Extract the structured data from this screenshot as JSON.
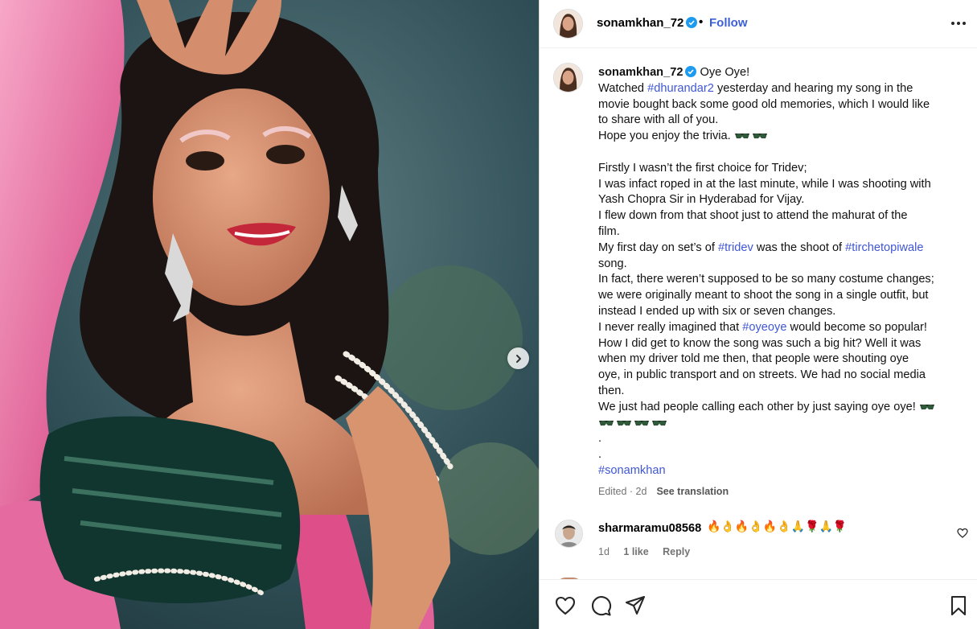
{
  "post": {
    "username": "sonamkhan_72",
    "follow_label": "Follow",
    "dot": "•",
    "caption_lines": [
      {
        "text": "Watched "
      },
      {
        "text": "movie bought back some good old memories, which I would like"
      },
      {
        "text": "to share with all of you."
      },
      {
        "text": "Hope you enjoy the trivia."
      },
      {
        "text": ""
      },
      {
        "text": "Firstly I wasn’t the first choice for Tridev;"
      },
      {
        "text": "I was infact roped in at the last minute, while I was shooting with"
      },
      {
        "text": "Yash Chopra Sir in Hyderabad for Vijay."
      },
      {
        "text": "I flew down from that shoot just to attend the mahurat of the"
      },
      {
        "text": "film."
      },
      {
        "text": "My first day on set’s of "
      },
      {
        "text": "song."
      },
      {
        "text": "In fact, there weren’t supposed to be so many costume changes;"
      },
      {
        "text": "we were originally meant to shoot the song in a single outfit, but"
      },
      {
        "text": "instead I ended up with six or seven changes."
      },
      {
        "text": "I never really imagined that "
      },
      {
        "text": "How I did get to know the song was such a big hit? Well it was"
      },
      {
        "text": "when my driver told me then, that people were shouting oye"
      },
      {
        "text": "oye, in public transport and on streets. We had no social media"
      },
      {
        "text": "then."
      },
      {
        "text": "We just had people calling each other by just saying oye oye!"
      },
      {
        "text": "."
      },
      {
        "text": "."
      }
    ],
    "first_line": "Oye Oye!",
    "hashtags": {
      "dhurandar2": "#dhurandar2",
      "dhurandar2_after": " yesterday and hearing my song in the",
      "tridev": "#tridev",
      "tridev_after": " was the shoot of ",
      "tirchetopiwale": "#tirchetopiwale",
      "oyeoye": "#oyeoye",
      "oyeoye_after": " would become so popular!",
      "sonamkhan": "#sonamkhan"
    },
    "edited": "Edited · 2d",
    "see_translation": "See translation"
  },
  "comment": {
    "username": "sharmaramu08568",
    "emojis": "🔥👌🔥👌🔥👌🙏🌹🙏🌹",
    "age": "1d",
    "likes": "1 like",
    "reply": "Reply"
  },
  "icons": [
    "verified-badge-icon",
    "more-options-icon",
    "chevron-right-icon",
    "heart-icon",
    "comment-icon",
    "share-icon",
    "bookmark-icon",
    "sunglasses-emoji"
  ],
  "colors": {
    "link": "#3f57d4",
    "follow": "#3b5fd6",
    "verified": "#1d9bf0",
    "muted": "#737373"
  }
}
